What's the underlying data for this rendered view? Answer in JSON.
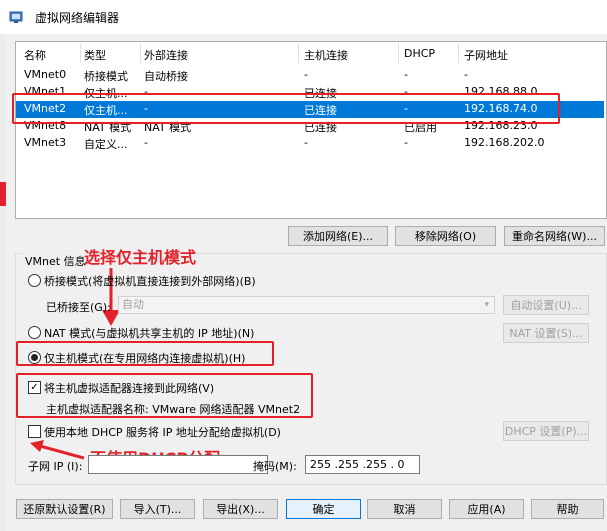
{
  "window": {
    "title": "虚拟网络编辑器"
  },
  "table": {
    "headers": [
      "名称",
      "类型",
      "外部连接",
      "主机连接",
      "DHCP",
      "子网地址"
    ],
    "rows": [
      [
        "VMnet0",
        "桥接模式",
        "自动桥接",
        "-",
        "-",
        "-"
      ],
      [
        "VMnet1",
        "仅主机...",
        "-",
        "已连接",
        "-",
        "192.168.88.0"
      ],
      [
        "VMnet2",
        "仅主机...",
        "-",
        "已连接",
        "-",
        "192.168.74.0"
      ],
      [
        "VMnet8",
        "NAT 模式",
        "NAT 模式",
        "已连接",
        "已启用",
        "192.168.23.0"
      ],
      [
        "VMnet3",
        "自定义...",
        "-",
        "-",
        "-",
        "192.168.202.0"
      ]
    ],
    "selected_row": 2
  },
  "table_buttons": {
    "add": "添加网络(E)...",
    "remove": "移除网络(O)",
    "rename": "重命名网络(W)..."
  },
  "vmnet_info": {
    "label": "VMnet 信息",
    "bridged_label": "桥接模式(将虚拟机直接连接到外部网络)(B)",
    "bridged_to_label": "已桥接至(G):",
    "bridged_to_value": "自动",
    "auto_settings": "自动设置(U)...",
    "nat_label": "NAT 模式(与虚拟机共享主机的 IP 地址)(N)",
    "nat_settings": "NAT 设置(S)...",
    "hostonly_label": "仅主机模式(在专用网络内连接虚拟机)(H)",
    "selected_mode": "hostonly",
    "connect_adapter_label": "将主机虚拟适配器连接到此网络(V)",
    "connect_adapter_checked": true,
    "adapter_name_label": "主机虚拟适配器名称: VMware 网络适配器 VMnet2",
    "dhcp_label": "使用本地 DHCP 服务将 IP 地址分配给虚拟机(D)",
    "dhcp_checked": false,
    "dhcp_settings": "DHCP 设置(P)...",
    "subnet_ip_label": "子网 IP (I):",
    "subnet_mask_label": "掩码(M):",
    "subnet_mask_value": "255 .255 .255 . 0"
  },
  "annotations": {
    "select_hostonly": "选择仅主机模式",
    "no_dhcp": "不使用DHCP分配"
  },
  "bottom_buttons": {
    "restore": "还原默认设置(R)",
    "import": "导入(T)...",
    "export": "导出(X)...",
    "ok": "确定",
    "cancel": "取消",
    "apply": "应用(A)",
    "help": "帮助"
  },
  "colors": {
    "selection": "#0078d7",
    "annotation_red": "#e3212b"
  }
}
